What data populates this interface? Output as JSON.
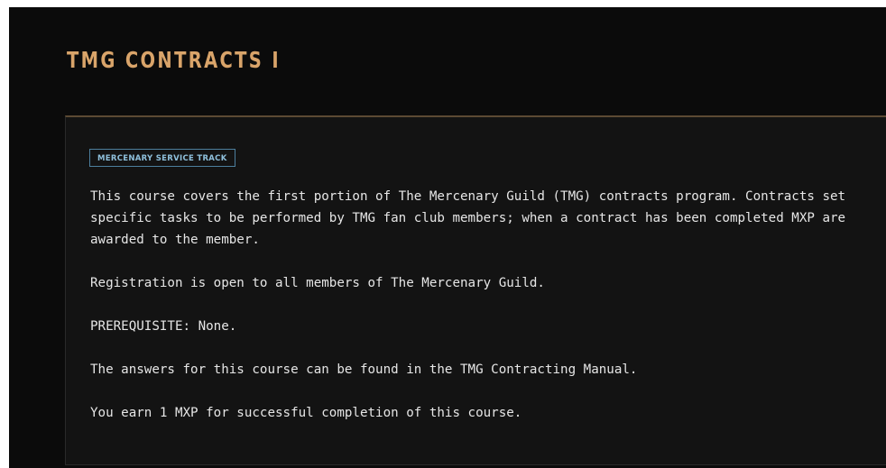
{
  "course": {
    "title": "TMG CONTRACTS I",
    "track_badge": "MERCENARY SERVICE TRACK",
    "description": "This course covers the first portion of The Mercenary Guild (TMG) contracts program. Contracts set specific tasks to be performed by TMG fan club members; when a contract has been completed MXP are awarded to the member.",
    "registration": "Registration is open to all members of The Mercenary Guild.",
    "prerequisite": "PREREQUISITE: None.",
    "answers_note": "The answers for this course can be found in the TMG Contracting Manual.",
    "reward": "You earn 1 MXP for successful completion of this course."
  },
  "colors": {
    "page_background": "#0b0b0b",
    "card_background": "#131313",
    "title": "#d9a46a",
    "badge": "#8fc0dc",
    "text": "#e6e6e6"
  }
}
